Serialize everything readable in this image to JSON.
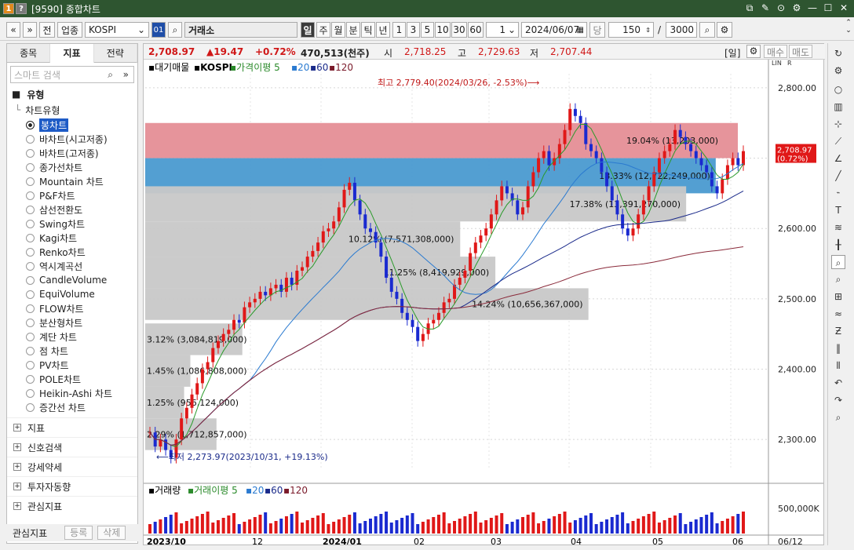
{
  "window": {
    "badge1": "1",
    "badge2": "?",
    "title": "[9590] 종합차트",
    "controls": [
      "⧉",
      "✎",
      "⊙",
      "⚙",
      "—",
      "☐",
      "✕"
    ]
  },
  "toolbar": {
    "nav_prev": "«",
    "nav_down": "»",
    "btn_jeon": "전",
    "btn_upjong": "업종",
    "symbol": "KOSPI",
    "code_btn": "01",
    "market": "거래소",
    "periods": [
      "일",
      "주",
      "월",
      "분",
      "틱",
      "년"
    ],
    "active_period": "일",
    "ranges": [
      "1",
      "3",
      "5",
      "10",
      "30",
      "60"
    ],
    "count": "1",
    "date": "2024/06/07",
    "dang": "당",
    "bars": "150",
    "slash": "/",
    "total": "3000"
  },
  "left": {
    "tabs": [
      "종목",
      "지표",
      "전략"
    ],
    "active_tab": "지표",
    "search_placeholder": "스마트 검색",
    "section_type": "유형",
    "subsection": "차트유형",
    "chart_types": [
      "봉차트",
      "바차트(시고저종)",
      "바차트(고저종)",
      "종가선차트",
      "Mountain 차트",
      "P&F차트",
      "삼선전환도",
      "Swing차트",
      "Kagi차트",
      "Renko차트",
      "역시계곡선",
      "CandleVolume",
      "EquiVolume",
      "FLOW차트",
      "분산형차트",
      "계단 차트",
      "점 차트",
      "PV차트",
      "POLE차트",
      "Heikin-Ashi 차트",
      "증간선 차트"
    ],
    "selected_type": "봉차트",
    "sections": [
      "지표",
      "신호검색",
      "강세약세",
      "투자자동향",
      "관심지표"
    ],
    "fav_label": "관심지표",
    "fav_register": "등록",
    "fav_delete": "삭제"
  },
  "info": {
    "price": "2,708.97",
    "change": "▲19.47",
    "pct": "+0.72%",
    "volume": "470,513(천주)",
    "open_lbl": "시",
    "open": "2,718.25",
    "high_lbl": "고",
    "high": "2,729.63",
    "low_lbl": "저",
    "low": "2,707.44",
    "period_tag": "[일]",
    "buy": "매수",
    "sell": "매도"
  },
  "main_chart": {
    "legend": {
      "a": "대기매물",
      "b": "KOSPI",
      "c": "가격이평 5",
      "d": "20",
      "e": "60",
      "f": "120"
    },
    "hi_label": "최고 2,779.40(2024/03/26, -2.53%)⟶",
    "lo_label": "⟵최저 2,273.97(2023/10/31, +19.13%)",
    "y_ticks": [
      "2,800.00",
      "2,700.00",
      "2,600.00",
      "2,500.00",
      "2,400.00",
      "2,300.00"
    ],
    "y_values": [
      2800,
      2700,
      2600,
      2500,
      2400,
      2300
    ],
    "current_price": "2,708.97",
    "current_pct": "(0.72%)",
    "x_ticks": [
      "2023/10",
      "12",
      "2024/01",
      "02",
      "03",
      "04",
      "05",
      "06"
    ],
    "last_date": "06/12",
    "corner_a": "LIN",
    "corner_b": "R"
  },
  "chart_data": {
    "type": "candlestick",
    "price_range": [
      2260,
      2820
    ],
    "volume_profile": [
      {
        "pct": "19.04%",
        "vol": "(13,203,000)",
        "low": 2700,
        "high": 2750,
        "color": "#e58e96"
      },
      {
        "pct": "18.33%",
        "vol": "(12,722,249,000)",
        "low": 2650,
        "high": 2700,
        "color": "#4a9ad0"
      },
      {
        "pct": "17.38%",
        "vol": "(13,391,270,000)",
        "low": 2610,
        "high": 2660,
        "color": "#c8c8c8"
      },
      {
        "pct": "10.12%",
        "vol": "(7,571,308,000)",
        "low": 2560,
        "high": 2610,
        "color": "#c8c8c8"
      },
      {
        "pct": "11.25%",
        "vol": "(8,419,929,000)",
        "low": 2515,
        "high": 2560,
        "color": "#c8c8c8"
      },
      {
        "pct": "14.24%",
        "vol": "(10,656,367,000)",
        "low": 2470,
        "high": 2515,
        "color": "#c8c8c8"
      },
      {
        "pct": "3.12%",
        "vol": "(3,084,819,000)",
        "low": 2420,
        "high": 2465,
        "color": "#c8c8c8"
      },
      {
        "pct": "1.45%",
        "vol": "(1,086,808,000)",
        "low": 2375,
        "high": 2420,
        "color": "#c8c8c8"
      },
      {
        "pct": "1.25%",
        "vol": "(956,124,000)",
        "low": 2330,
        "high": 2375,
        "color": "#c8c8c8"
      },
      {
        "pct": "2.29%",
        "vol": "(1,712,857,000)",
        "low": 2285,
        "high": 2330,
        "color": "#c8c8c8"
      }
    ],
    "closes": [
      2310,
      2290,
      2300,
      2285,
      2274,
      2300,
      2330,
      2345,
      2364,
      2380,
      2400,
      2410,
      2430,
      2440,
      2450,
      2456,
      2470,
      2466,
      2488,
      2495,
      2500,
      2510,
      2505,
      2515,
      2520,
      2510,
      2530,
      2520,
      2540,
      2545,
      2560,
      2568,
      2580,
      2596,
      2600,
      2610,
      2630,
      2655,
      2665,
      2640,
      2620,
      2600,
      2595,
      2580,
      2560,
      2530,
      2510,
      2500,
      2480,
      2470,
      2460,
      2440,
      2450,
      2465,
      2470,
      2480,
      2495,
      2500,
      2520,
      2530,
      2540,
      2565,
      2580,
      2590,
      2600,
      2620,
      2640,
      2660,
      2650,
      2640,
      2620,
      2630,
      2660,
      2680,
      2700,
      2710,
      2690,
      2700,
      2720,
      2740,
      2770,
      2760,
      2750,
      2720,
      2710,
      2700,
      2680,
      2660,
      2640,
      2620,
      2600,
      2590,
      2600,
      2620,
      2640,
      2660,
      2680,
      2700,
      2710,
      2720,
      2740,
      2730,
      2720,
      2710,
      2700,
      2690,
      2680,
      2660,
      2650,
      2670,
      2690,
      2700,
      2690,
      2710
    ],
    "volume_label": "거래량",
    "volume_ma": "거래이평 5",
    "volume_ma2": "20",
    "volume_ma3": "60",
    "volume_ma4": "120",
    "volume_tick": "500,000K"
  }
}
